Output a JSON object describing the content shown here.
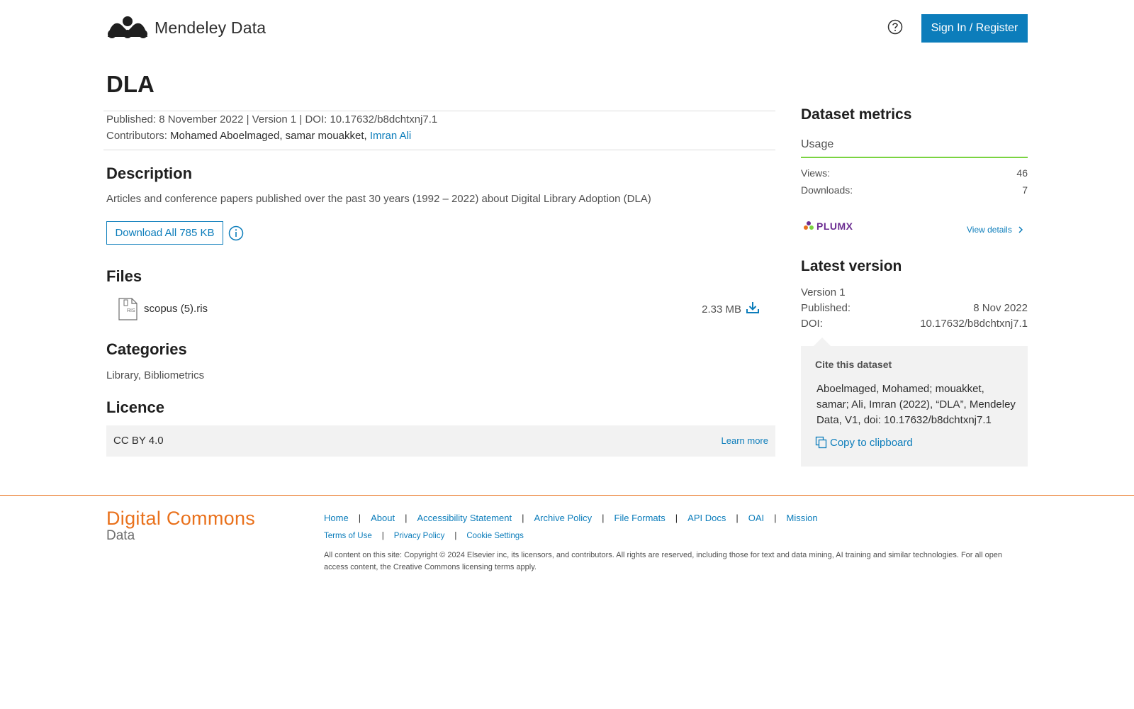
{
  "header": {
    "logo_text": "Mendeley Data",
    "sign_in_label": "Sign In / Register"
  },
  "dataset": {
    "title": "DLA",
    "published_label": "Published: 8 November 2022 | Version 1 | DOI: 10.17632/b8dchtxnj7.1",
    "contributors_label": "Contributors:",
    "contributors_plain": "Mohamed Aboelmaged, samar mouakket,",
    "contributor_link": "Imran Ali",
    "description_heading": "Description",
    "description": "Articles and conference papers published over the past 30 years (1992 – 2022) about Digital Library Adoption (DLA)",
    "download_all_label": "Download All 785 KB",
    "files_heading": "Files",
    "files": [
      {
        "name": "scopus (5).ris",
        "size": "2.33 MB",
        "icon": "ris-file-icon"
      }
    ],
    "categories_heading": "Categories",
    "categories": "Library, Bibliometrics",
    "licence_heading": "Licence",
    "licence_name": "CC BY 4.0",
    "licence_learn_more": "Learn more"
  },
  "sidebar": {
    "metrics_heading": "Dataset metrics",
    "usage_tab": "Usage",
    "views_label": "Views:",
    "views_value": "46",
    "downloads_label": "Downloads:",
    "downloads_value": "7",
    "plumx_label": "PLUMX",
    "view_details": "View details",
    "latest_heading": "Latest version",
    "version_label": "Version 1",
    "published_label": "Published:",
    "published_value": "8 Nov 2022",
    "doi_label": "DOI:",
    "doi_value": "10.17632/b8dchtxnj7.1",
    "cite_heading": "Cite this dataset",
    "cite_text": "Aboelmaged, Mohamed; mouakket, samar; Ali, Imran (2022), “DLA”, Mendeley Data, V1, doi: 10.17632/b8dchtxnj7.1",
    "copy_label": "Copy to clipboard"
  },
  "footer": {
    "brand_main": "Digital Commons",
    "brand_sub": "Data",
    "links": [
      "Home",
      "About",
      "Accessibility Statement",
      "Archive Policy",
      "File Formats",
      "API Docs",
      "OAI",
      "Mission"
    ],
    "links2": [
      "Terms of Use",
      "Privacy Policy",
      "Cookie Settings"
    ],
    "separator": "|",
    "copyright": "All content on this site: Copyright © 2024 Elsevier inc, its licensors, and contributors. All rights are reserved, including those for text and data mining, AI training and similar technologies. For all open access content, the Creative Commons licensing terms apply."
  },
  "colors": {
    "accent": "#0c7dbb",
    "brand_orange": "#e9711c",
    "usage_green": "#7ad341",
    "plumx_purple": "#6b2c91"
  }
}
